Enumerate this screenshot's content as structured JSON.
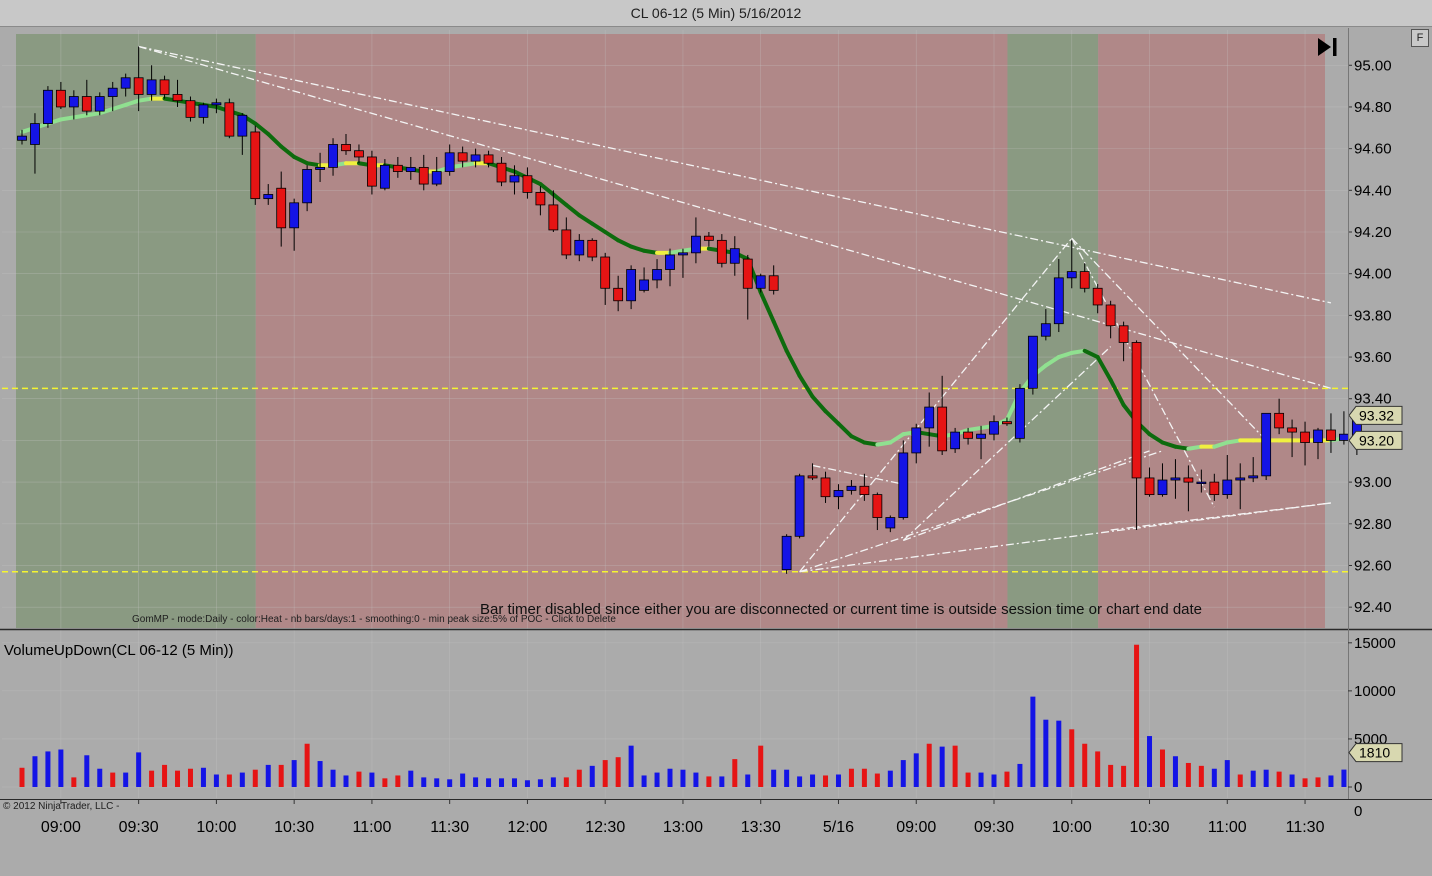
{
  "window": {
    "title": "CL 06-12 (5 Min)  5/16/2012",
    "f_button": "F"
  },
  "price_panel": {
    "session_label": "GomMP - mode:Daily  - color:Heat - nb bars/days:1  - smoothing:0 - min peak size:5% of POC - Click to Delete",
    "bar_timer_message": "Bar timer disabled since either you are disconnected or current time is outside session time or chart end date",
    "last_price_label": "93.32",
    "ma_price_label": "93.20",
    "hlines": [
      93.45,
      92.57
    ]
  },
  "volume_panel": {
    "title": "VolumeUpDown(CL 06-12 (5 Min))",
    "last_volume_label": "1810"
  },
  "footer": {
    "copyright": "© 2012 NinjaTrader, LLC   -"
  },
  "colors": {
    "up": "#1414e6",
    "down": "#e61414",
    "ma_green": "#0d6b0d",
    "ma_light": "#90e090",
    "ma_yellow": "#f0f040",
    "profile_green": "#8a9a82",
    "profile_red": "#b08888",
    "hline": "#f5f530"
  },
  "chart_data": [
    {
      "type": "candlestick",
      "title": "CL 06-12 (5 Min)",
      "ylim": [
        92.3,
        95.15
      ],
      "y_ticks": [
        95.0,
        94.8,
        94.6,
        94.4,
        94.2,
        94.0,
        93.8,
        93.6,
        93.4,
        93.2,
        93.0,
        92.8,
        92.6,
        92.4
      ],
      "y_tick_labels": [
        "95.00",
        "94.80",
        "94.60",
        "94.40",
        "94.20",
        "94.00",
        "93.80",
        "93.60",
        "93.40",
        "93.20",
        "93.00",
        "92.80",
        "92.60",
        "92.40"
      ],
      "x_labels": [
        {
          "bar": 3,
          "label": "09:00"
        },
        {
          "bar": 9,
          "label": "09:30"
        },
        {
          "bar": 15,
          "label": "10:00"
        },
        {
          "bar": 21,
          "label": "10:30"
        },
        {
          "bar": 27,
          "label": "11:00"
        },
        {
          "bar": 33,
          "label": "11:30"
        },
        {
          "bar": 39,
          "label": "12:00"
        },
        {
          "bar": 45,
          "label": "12:30"
        },
        {
          "bar": 51,
          "label": "13:00"
        },
        {
          "bar": 57,
          "label": "13:30"
        },
        {
          "bar": 63,
          "label": "5/16"
        },
        {
          "bar": 69,
          "label": "09:00"
        },
        {
          "bar": 75,
          "label": "09:30"
        },
        {
          "bar": 81,
          "label": "10:00"
        },
        {
          "bar": 87,
          "label": "10:30"
        },
        {
          "bar": 93,
          "label": "11:00"
        },
        {
          "bar": 99,
          "label": "11:30"
        }
      ],
      "sessions": [
        {
          "from": 0,
          "to": 18.5,
          "zone": "green"
        },
        {
          "from": 18.5,
          "to": 76.5,
          "zone": "red"
        },
        {
          "from": 76.5,
          "to": 83.5,
          "zone": "green"
        },
        {
          "from": 83.5,
          "to": 101,
          "zone": "red"
        }
      ],
      "ohlc": [
        [
          94.64,
          94.69,
          94.62,
          94.66
        ],
        [
          94.62,
          94.77,
          94.48,
          94.72
        ],
        [
          94.72,
          94.9,
          94.7,
          94.88
        ],
        [
          94.88,
          94.92,
          94.79,
          94.8
        ],
        [
          94.8,
          94.88,
          94.74,
          94.85
        ],
        [
          94.85,
          94.93,
          94.76,
          94.78
        ],
        [
          94.78,
          94.87,
          94.76,
          94.85
        ],
        [
          94.85,
          94.92,
          94.78,
          94.89
        ],
        [
          94.89,
          94.96,
          94.85,
          94.94
        ],
        [
          94.94,
          95.09,
          94.78,
          94.86
        ],
        [
          94.86,
          95.0,
          94.83,
          94.93
        ],
        [
          94.93,
          94.95,
          94.84,
          94.86
        ],
        [
          94.86,
          94.93,
          94.8,
          94.83
        ],
        [
          94.83,
          94.85,
          94.73,
          94.75
        ],
        [
          94.75,
          94.82,
          94.72,
          94.81
        ],
        [
          94.81,
          94.84,
          94.77,
          94.82
        ],
        [
          94.82,
          94.84,
          94.65,
          94.66
        ],
        [
          94.66,
          94.77,
          94.57,
          94.76
        ],
        [
          94.68,
          94.71,
          94.33,
          94.36
        ],
        [
          94.36,
          94.43,
          94.33,
          94.38
        ],
        [
          94.41,
          94.49,
          94.13,
          94.22
        ],
        [
          94.22,
          94.36,
          94.11,
          94.34
        ],
        [
          94.34,
          94.52,
          94.3,
          94.5
        ],
        [
          94.5,
          94.58,
          94.44,
          94.51
        ],
        [
          94.51,
          94.65,
          94.47,
          94.62
        ],
        [
          94.62,
          94.67,
          94.57,
          94.59
        ],
        [
          94.59,
          94.62,
          94.53,
          94.56
        ],
        [
          94.56,
          94.59,
          94.38,
          94.42
        ],
        [
          94.41,
          94.55,
          94.4,
          94.52
        ],
        [
          94.52,
          94.56,
          94.46,
          94.49
        ],
        [
          94.49,
          94.56,
          94.45,
          94.51
        ],
        [
          94.51,
          94.57,
          94.4,
          94.43
        ],
        [
          94.43,
          94.56,
          94.42,
          94.49
        ],
        [
          94.49,
          94.62,
          94.47,
          94.58
        ],
        [
          94.58,
          94.61,
          94.51,
          94.54
        ],
        [
          94.54,
          94.6,
          94.51,
          94.57
        ],
        [
          94.57,
          94.59,
          94.51,
          94.53
        ],
        [
          94.53,
          94.56,
          94.42,
          94.44
        ],
        [
          94.44,
          94.52,
          94.38,
          94.47
        ],
        [
          94.47,
          94.51,
          94.36,
          94.39
        ],
        [
          94.39,
          94.42,
          94.28,
          94.33
        ],
        [
          94.33,
          94.4,
          94.2,
          94.21
        ],
        [
          94.21,
          94.27,
          94.07,
          94.09
        ],
        [
          94.09,
          94.19,
          94.06,
          94.16
        ],
        [
          94.16,
          94.17,
          94.06,
          94.08
        ],
        [
          94.08,
          94.1,
          93.85,
          93.93
        ],
        [
          93.93,
          93.99,
          93.82,
          93.87
        ],
        [
          93.87,
          94.04,
          93.83,
          94.02
        ],
        [
          93.92,
          94.03,
          93.91,
          93.97
        ],
        [
          93.97,
          94.07,
          93.93,
          94.02
        ],
        [
          94.02,
          94.12,
          93.94,
          94.09
        ],
        [
          94.09,
          94.12,
          93.98,
          94.1
        ],
        [
          94.1,
          94.27,
          94.05,
          94.18
        ],
        [
          94.18,
          94.2,
          94.13,
          94.16
        ],
        [
          94.16,
          94.19,
          94.03,
          94.05
        ],
        [
          94.05,
          94.18,
          93.99,
          94.12
        ],
        [
          94.07,
          94.09,
          93.78,
          93.93
        ],
        [
          93.93,
          94.0,
          93.91,
          93.99
        ],
        [
          93.99,
          94.04,
          93.9,
          93.92
        ],
        [
          92.58,
          92.75,
          92.56,
          92.74
        ],
        [
          92.74,
          93.04,
          92.73,
          93.03
        ],
        [
          93.03,
          93.09,
          93.01,
          93.02
        ],
        [
          93.02,
          93.05,
          92.9,
          92.93
        ],
        [
          92.93,
          92.99,
          92.87,
          92.96
        ],
        [
          92.96,
          93.01,
          92.94,
          92.98
        ],
        [
          92.98,
          93.04,
          92.91,
          92.94
        ],
        [
          92.94,
          92.95,
          92.77,
          92.83
        ],
        [
          92.78,
          92.84,
          92.76,
          92.83
        ],
        [
          92.83,
          93.2,
          92.82,
          93.14
        ],
        [
          93.14,
          93.28,
          93.09,
          93.26
        ],
        [
          93.26,
          93.43,
          93.17,
          93.36
        ],
        [
          93.36,
          93.51,
          93.13,
          93.15
        ],
        [
          93.16,
          93.26,
          93.14,
          93.24
        ],
        [
          93.24,
          93.26,
          93.18,
          93.21
        ],
        [
          93.21,
          93.27,
          93.11,
          93.23
        ],
        [
          93.23,
          93.32,
          93.2,
          93.29
        ],
        [
          93.29,
          93.31,
          93.27,
          93.28
        ],
        [
          93.21,
          93.47,
          93.19,
          93.45
        ],
        [
          93.45,
          93.7,
          93.42,
          93.7
        ],
        [
          93.7,
          93.83,
          93.68,
          93.76
        ],
        [
          93.76,
          94.07,
          93.72,
          93.98
        ],
        [
          93.98,
          94.16,
          93.93,
          94.01
        ],
        [
          94.01,
          94.05,
          93.91,
          93.93
        ],
        [
          93.93,
          93.95,
          93.81,
          93.85
        ],
        [
          93.85,
          93.87,
          93.69,
          93.75
        ],
        [
          93.75,
          93.77,
          93.58,
          93.67
        ],
        [
          93.67,
          93.68,
          92.77,
          93.02
        ],
        [
          93.02,
          93.07,
          92.93,
          92.94
        ],
        [
          92.94,
          93.09,
          92.93,
          93.01
        ],
        [
          93.01,
          93.11,
          92.92,
          93.02
        ],
        [
          93.02,
          93.08,
          92.86,
          93.0
        ],
        [
          93.0,
          93.06,
          92.95,
          93.0
        ],
        [
          93.0,
          93.04,
          92.91,
          92.94
        ],
        [
          92.94,
          93.13,
          92.92,
          93.01
        ],
        [
          93.01,
          93.09,
          92.87,
          93.02
        ],
        [
          93.02,
          93.12,
          93.0,
          93.03
        ],
        [
          93.03,
          93.22,
          93.01,
          93.33
        ],
        [
          93.33,
          93.4,
          93.23,
          93.26
        ],
        [
          93.26,
          93.3,
          93.12,
          93.24
        ],
        [
          93.24,
          93.29,
          93.08,
          93.19
        ],
        [
          93.19,
          93.26,
          93.11,
          93.25
        ],
        [
          93.25,
          93.33,
          93.14,
          93.2
        ],
        [
          93.2,
          93.34,
          93.18,
          93.23
        ],
        [
          93.21,
          93.31,
          93.13,
          93.32
        ]
      ],
      "moving_average": [
        94.68,
        94.7,
        94.72,
        94.74,
        94.75,
        94.76,
        94.77,
        94.79,
        94.81,
        94.83,
        94.84,
        94.84,
        94.83,
        94.82,
        94.81,
        94.8,
        94.78,
        94.76,
        94.72,
        94.67,
        94.61,
        94.56,
        94.53,
        94.52,
        94.52,
        94.53,
        94.53,
        94.52,
        94.52,
        94.51,
        94.5,
        94.49,
        94.49,
        94.51,
        94.52,
        94.53,
        94.53,
        94.51,
        94.49,
        94.46,
        94.43,
        94.38,
        94.33,
        94.28,
        94.24,
        94.2,
        94.16,
        94.13,
        94.11,
        94.1,
        94.1,
        94.11,
        94.12,
        94.12,
        94.11,
        94.1,
        94.07,
        93.91,
        93.77,
        93.63,
        93.51,
        93.41,
        93.34,
        93.28,
        93.22,
        93.19,
        93.18,
        93.19,
        93.23,
        93.24,
        93.23,
        93.22,
        93.23,
        93.25,
        93.26,
        93.27,
        93.3,
        93.43,
        93.51,
        93.56,
        93.6,
        93.62,
        93.63,
        93.6,
        93.49,
        93.37,
        93.29,
        93.23,
        93.19,
        93.17,
        93.16,
        93.17,
        93.17,
        93.19,
        93.2,
        93.2,
        93.2,
        93.2,
        93.2,
        93.2,
        93.2,
        93.2,
        93.21
      ],
      "trendlines": [
        {
          "from": [
            9,
            95.09
          ],
          "to": [
            101,
            93.45
          ]
        },
        {
          "from": [
            9,
            95.09
          ],
          "to": [
            101,
            93.86
          ]
        },
        {
          "from": [
            60,
            92.57
          ],
          "to": [
            101,
            92.9
          ]
        },
        {
          "from": [
            60,
            92.57
          ],
          "to": [
            81,
            94.17
          ]
        },
        {
          "from": [
            60,
            92.57
          ],
          "to": [
            88,
            93.15
          ]
        },
        {
          "from": [
            61,
            93.08
          ],
          "to": [
            68,
            92.99
          ]
        },
        {
          "from": [
            68,
            92.72
          ],
          "to": [
            84,
            93.65
          ]
        },
        {
          "from": [
            68,
            92.72
          ],
          "to": [
            87,
            93.15
          ]
        },
        {
          "from": [
            81,
            94.17
          ],
          "to": [
            92,
            92.88
          ]
        },
        {
          "from": [
            81,
            94.17
          ],
          "to": [
            96,
            93.2
          ]
        },
        {
          "from": [
            84,
            92.77
          ],
          "to": [
            101,
            92.9
          ]
        }
      ]
    },
    {
      "type": "bar",
      "title": "VolumeUpDown(CL 06-12 (5 Min))",
      "ylim": [
        0,
        15500
      ],
      "y_ticks": [
        15000,
        10000,
        5000,
        0
      ],
      "y_tick_labels": [
        "15000",
        "10000",
        "5000",
        "0"
      ],
      "values": [
        2000,
        3200,
        3700,
        3900,
        1000,
        3300,
        1900,
        1500,
        1500,
        3600,
        1700,
        2300,
        1700,
        1900,
        2000,
        1300,
        1300,
        1500,
        1800,
        2300,
        2300,
        2800,
        4500,
        2700,
        1800,
        1200,
        1600,
        1500,
        900,
        1200,
        1700,
        1000,
        900,
        800,
        1400,
        1000,
        900,
        900,
        900,
        700,
        800,
        1000,
        1000,
        1800,
        2200,
        2800,
        3100,
        4300,
        1200,
        1500,
        1900,
        1800,
        1500,
        1100,
        1100,
        2900,
        1300,
        4300,
        1800,
        1800,
        1100,
        1300,
        1200,
        1300,
        1900,
        1900,
        1400,
        1700,
        2800,
        3500,
        4500,
        4200,
        4300,
        1500,
        1500,
        1300,
        1600,
        2400,
        9400,
        7000,
        6900,
        6000,
        4500,
        3700,
        2300,
        2200,
        14800,
        5300,
        3900,
        3200,
        2500,
        2200,
        1900,
        2800,
        1300,
        1700,
        1800,
        1600,
        1300,
        900,
        1000,
        1200,
        1810
      ],
      "direction": [
        "d",
        "u",
        "u",
        "u",
        "d",
        "u",
        "u",
        "d",
        "u",
        "u",
        "d",
        "d",
        "d",
        "d",
        "u",
        "u",
        "d",
        "u",
        "d",
        "u",
        "d",
        "u",
        "d",
        "u",
        "u",
        "u",
        "d",
        "u",
        "d",
        "d",
        "u",
        "u",
        "u",
        "u",
        "u",
        "u",
        "u",
        "u",
        "u",
        "u",
        "u",
        "u",
        "d",
        "d",
        "u",
        "d",
        "d",
        "u",
        "u",
        "u",
        "u",
        "u",
        "u",
        "d",
        "u",
        "d",
        "u",
        "d",
        "u",
        "u",
        "u",
        "u",
        "d",
        "u",
        "d",
        "d",
        "d",
        "u",
        "u",
        "u",
        "d",
        "u",
        "d",
        "d",
        "u",
        "u",
        "d",
        "u",
        "u",
        "u",
        "u",
        "d",
        "d",
        "d",
        "d",
        "d",
        "d",
        "u",
        "d",
        "u",
        "d",
        "d",
        "u",
        "u",
        "d",
        "u",
        "u",
        "d",
        "u",
        "d",
        "d",
        "u",
        "u"
      ]
    }
  ]
}
